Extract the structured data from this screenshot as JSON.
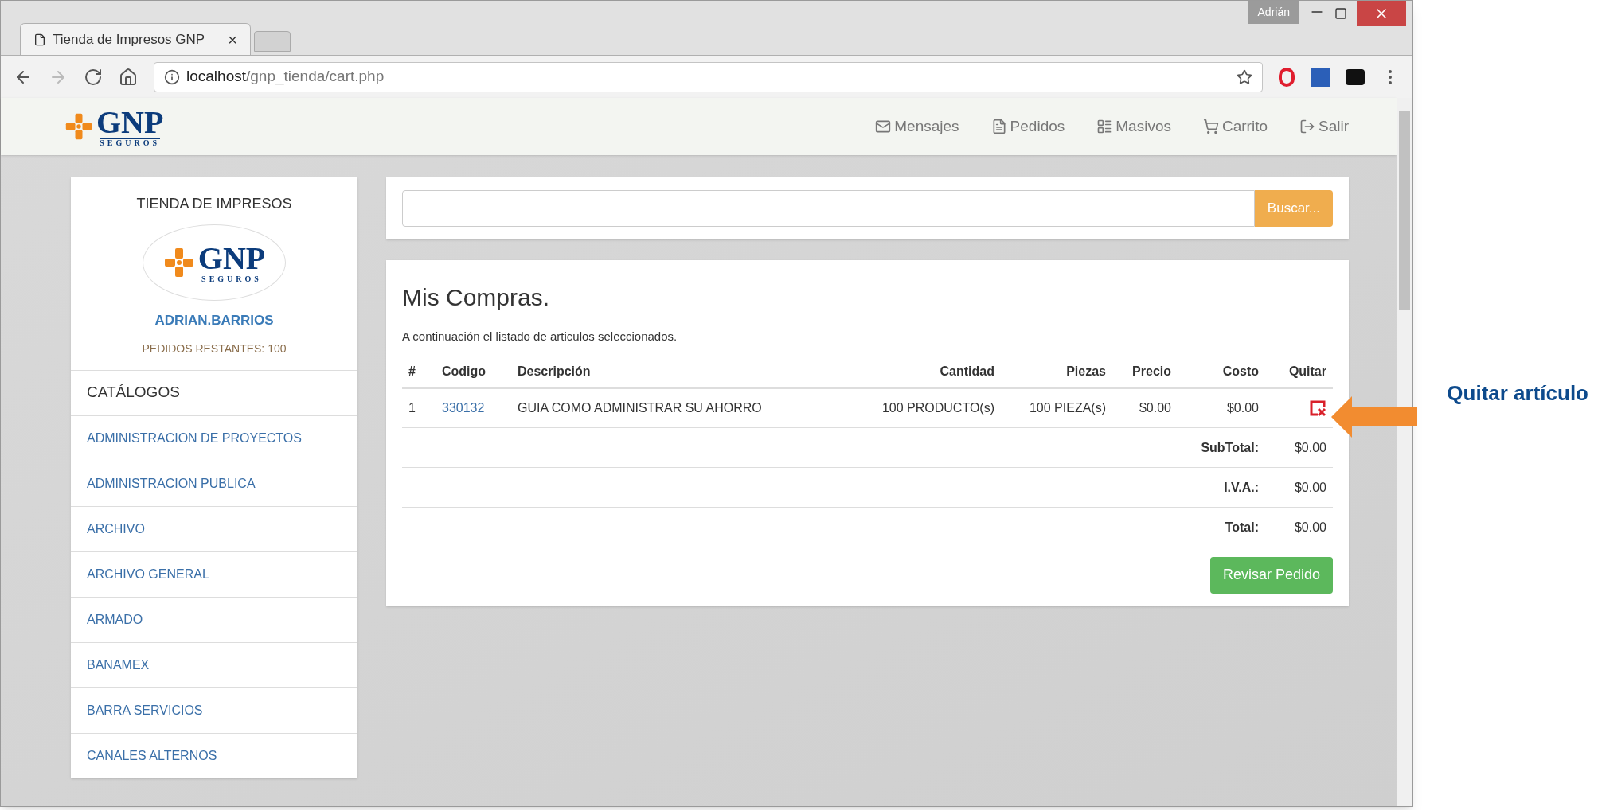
{
  "browser": {
    "tab_title": "Tienda de Impresos GNP",
    "tab_close": "×",
    "profile": "Adrián",
    "url_host": "localhost",
    "url_path": "/gnp_tienda/cart.php"
  },
  "header_logo": {
    "name": "GNP",
    "tagline": "SEGUROS"
  },
  "nav": [
    {
      "label": "Mensajes",
      "kind": "mail"
    },
    {
      "label": "Pedidos",
      "kind": "orders"
    },
    {
      "label": "Masivos",
      "kind": "list"
    },
    {
      "label": "Carrito",
      "kind": "cart"
    },
    {
      "label": "Salir",
      "kind": "logout"
    }
  ],
  "sidebar": {
    "title": "TIENDA DE IMPRESOS",
    "logo": {
      "name": "GNP",
      "tagline": "SEGUROS"
    },
    "user": "ADRIAN.BARRIOS",
    "remaining": "PEDIDOS RESTANTES: 100",
    "section": "CATÁLOGOS",
    "items": [
      "ADMINISTRACION DE PROYECTOS",
      "ADMINISTRACION PUBLICA",
      "ARCHIVO",
      "ARCHIVO GENERAL",
      "ARMADO",
      "BANAMEX",
      "BARRA SERVICIOS",
      "CANALES ALTERNOS"
    ]
  },
  "search": {
    "button": "Buscar..."
  },
  "cart": {
    "title": "Mis Compras.",
    "subtitle": "A continuación el listado de articulos seleccionados.",
    "columns": [
      "#",
      "Codigo",
      "Descripción",
      "Cantidad",
      "Piezas",
      "Precio",
      "Costo",
      "Quitar"
    ],
    "rows": [
      {
        "number": "1",
        "code": "330132",
        "description": "GUIA COMO ADMINISTRAR SU AHORRO",
        "quantity": "100 PRODUCTO(s)",
        "pieces": "100 PIEZA(s)",
        "price": "$0.00",
        "cost": "$0.00"
      }
    ],
    "totals": [
      {
        "label": "SubTotal:",
        "value": "$0.00"
      },
      {
        "label": "I.V.A.:",
        "value": "$0.00"
      },
      {
        "label": "Total:",
        "value": "$0.00"
      }
    ],
    "button": "Revisar Pedido"
  },
  "annotation": {
    "text": "Quitar artículo"
  }
}
